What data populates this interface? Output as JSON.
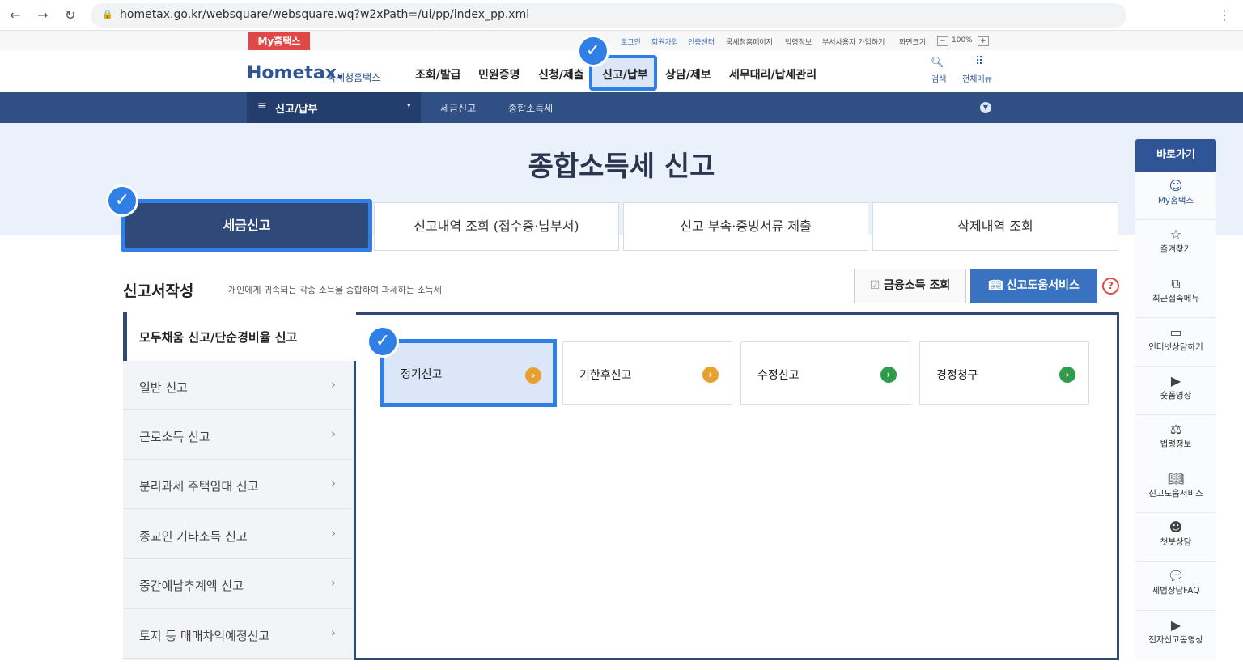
{
  "browser": {
    "url": "hometax.go.kr/websquare/websquare.wq?w2xPath=/ui/pp/index_pp.xml"
  },
  "util": {
    "my_badge": "My홈택스",
    "links": [
      "로그인",
      "회원가입",
      "인증센터",
      "국세청홈페이지",
      "법령정보",
      "부서사용자 가입하기",
      "화면크기"
    ],
    "zoom": "100%"
  },
  "header": {
    "logo": "Hometax.",
    "logo_sub": "국세청홈택스",
    "menu": [
      "조회/발급",
      "민원증명",
      "신청/제출",
      "신고/납부",
      "상담/제보",
      "세무대리/납세관리"
    ],
    "search": "검색",
    "all_menu": "전체메뉴"
  },
  "navbar": {
    "current": "신고/납부",
    "breadcrumb": [
      "세금신고",
      "종합소득세"
    ]
  },
  "page": {
    "title": "종합소득세 신고"
  },
  "tabs": [
    "세금신고",
    "신고내역 조회 (접수증·납부서)",
    "신고 부속·증빙서류 제출",
    "삭제내역 조회"
  ],
  "section": {
    "title": "신고서작성",
    "desc": "개인에게 귀속되는 각종 소득을 종합하여 과세하는 소득세",
    "btn_finance": "금융소득 조회",
    "btn_help": "신고도움서비스",
    "help": "?"
  },
  "left_menu": [
    "모두채움 신고/단순경비율 신고",
    "일반 신고",
    "근로소득 신고",
    "분리과세 주택임대 신고",
    "종교인 기타소득 신고",
    "중간예납추계액 신고",
    "토지 등 매매차익예정신고"
  ],
  "cards": [
    {
      "label": "정기신고",
      "color": "#e8a033"
    },
    {
      "label": "기한후신고",
      "color": "#e8a033"
    },
    {
      "label": "수정신고",
      "color": "#2e9c4a"
    },
    {
      "label": "경정청구",
      "color": "#2e9c4a"
    }
  ],
  "sidebar": {
    "title": "바로가기",
    "items": [
      {
        "label": "My홈택스",
        "icon": "user-icon"
      },
      {
        "label": "즐겨찾기",
        "icon": "star-icon"
      },
      {
        "label": "최근접속메뉴",
        "icon": "recent-icon"
      },
      {
        "label": "인터넷상담하기",
        "icon": "laptop-icon"
      },
      {
        "label": "숏폼영상",
        "icon": "play-icon"
      },
      {
        "label": "법령정보",
        "icon": "gavel-icon"
      },
      {
        "label": "신고도움서비스",
        "icon": "book-icon"
      },
      {
        "label": "챗봇상담",
        "icon": "chatbot-icon"
      },
      {
        "label": "세법상담FAQ",
        "icon": "chat-icon"
      },
      {
        "label": "전자신고동영상",
        "icon": "play-icon"
      }
    ]
  },
  "colors": {
    "navy": "#2f4a78",
    "highlight": "#2f7fe6"
  }
}
